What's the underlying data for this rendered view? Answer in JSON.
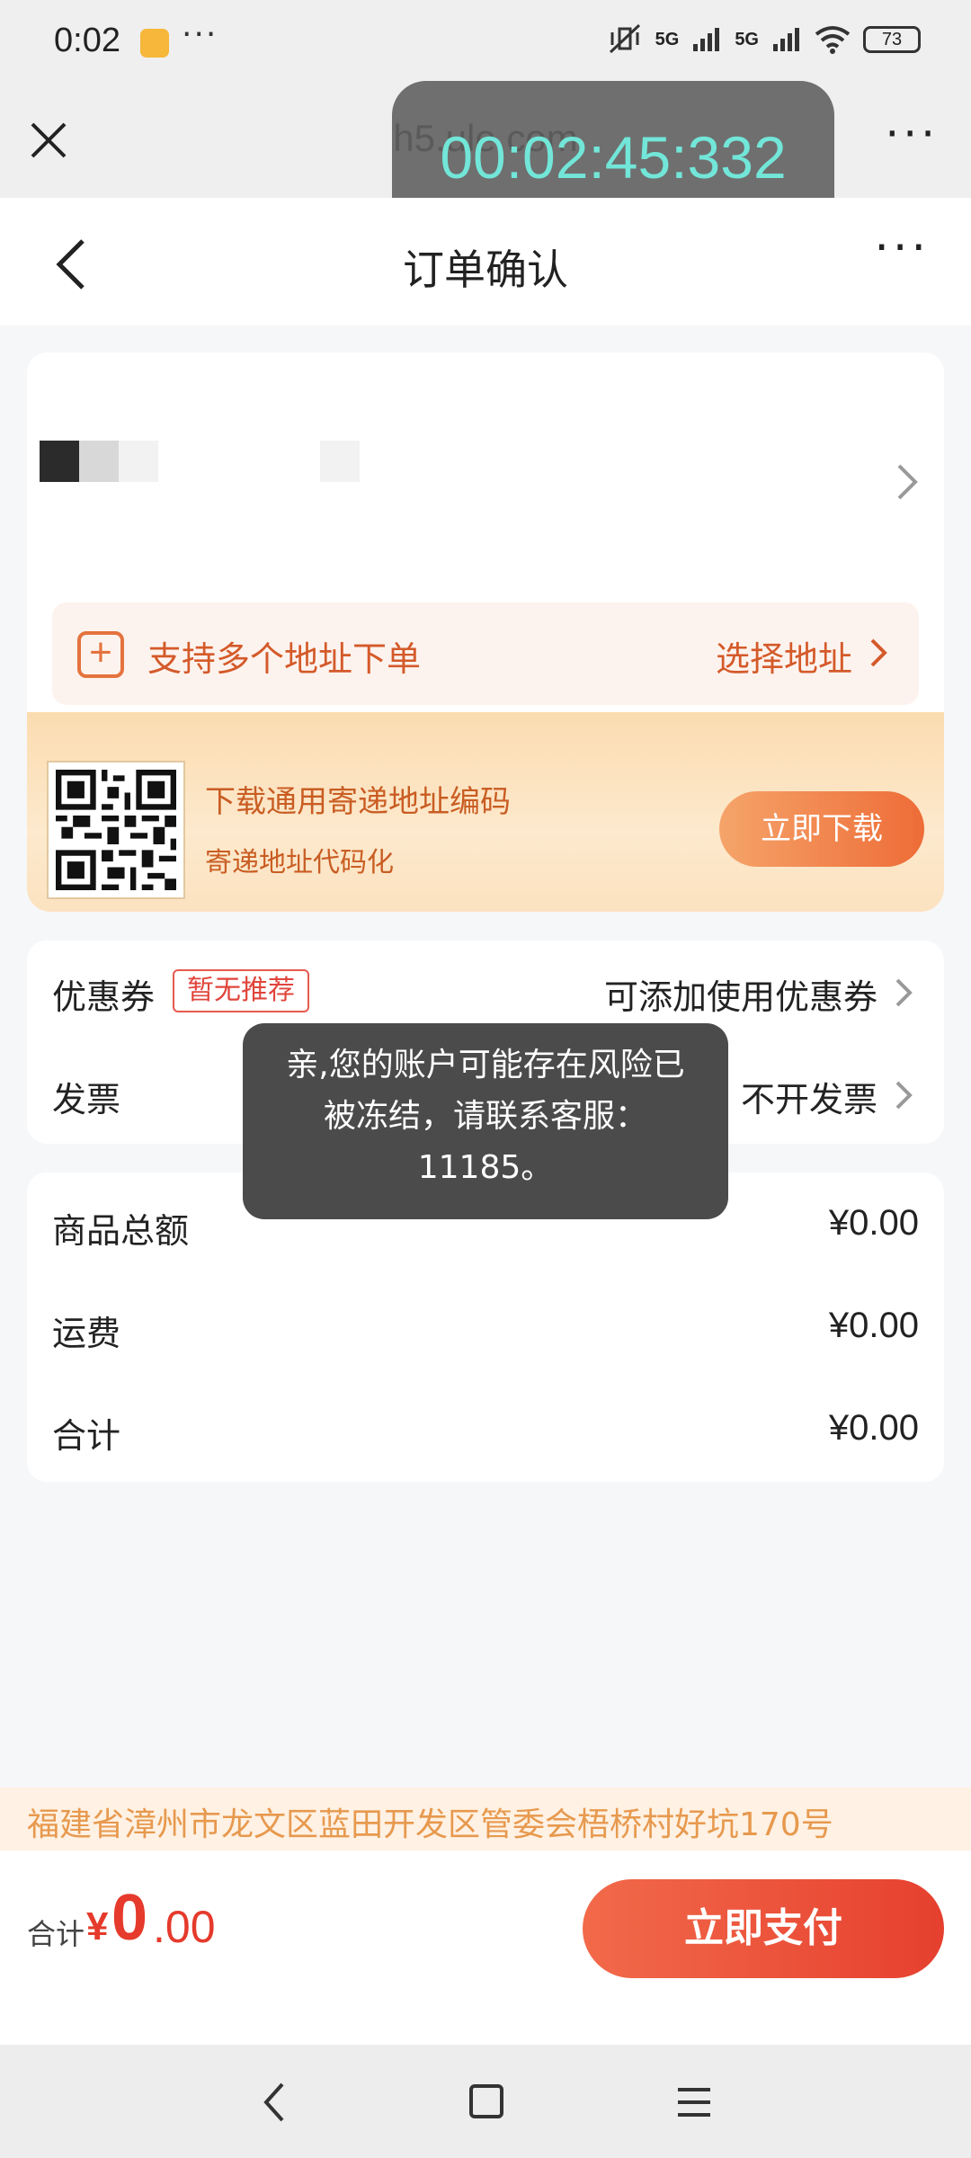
{
  "status_bar": {
    "time": "0:02",
    "dots": "···",
    "signal1": "5G",
    "signal2": "5G",
    "battery": "73"
  },
  "browser": {
    "url": "h5.ule.com",
    "more": "···"
  },
  "timer": "00:02:45:332",
  "page": {
    "title": "订单确认",
    "more": "···"
  },
  "address": {
    "multi_address_label": "支持多个地址下单",
    "select_address": "选择地址",
    "add_icon": "+"
  },
  "download_banner": {
    "title": "下载通用寄递地址编码",
    "subtitle": "寄递地址代码化",
    "button": "立即下载"
  },
  "options": {
    "coupon_label": "优惠券",
    "coupon_tag": "暂无推荐",
    "coupon_action": "可添加使用优惠券",
    "invoice_label": "发票",
    "invoice_value": "不开发票"
  },
  "summary": {
    "goods_total_label": "商品总额",
    "goods_total": "¥0.00",
    "shipping_label": "运费",
    "shipping": "¥0.00",
    "total_label": "合计",
    "total": "¥0.00"
  },
  "toast": {
    "message": "亲,您的账户可能存在风险已被冻结，请联系客服：11185。"
  },
  "address_strip": "福建省漳州市龙文区蓝田开发区管委会梧桥村好坑170号",
  "pay_bar": {
    "label": "合计",
    "currency": "¥",
    "amount_int": "0",
    "amount_dec": ".00",
    "button": "立即支付"
  },
  "icons": {
    "close": "close-icon",
    "back": "chevron-left-icon",
    "more": "more-icon",
    "arrow": "chevron-right-icon",
    "add": "add-square-icon",
    "qr": "qr-code-icon"
  },
  "colors": {
    "accent": "#e53a2c",
    "orange_text": "#d45a2a",
    "banner_bg": "#fbdcb0",
    "toast_bg": "#3c3c3c",
    "timer_text": "#72e6d8"
  }
}
